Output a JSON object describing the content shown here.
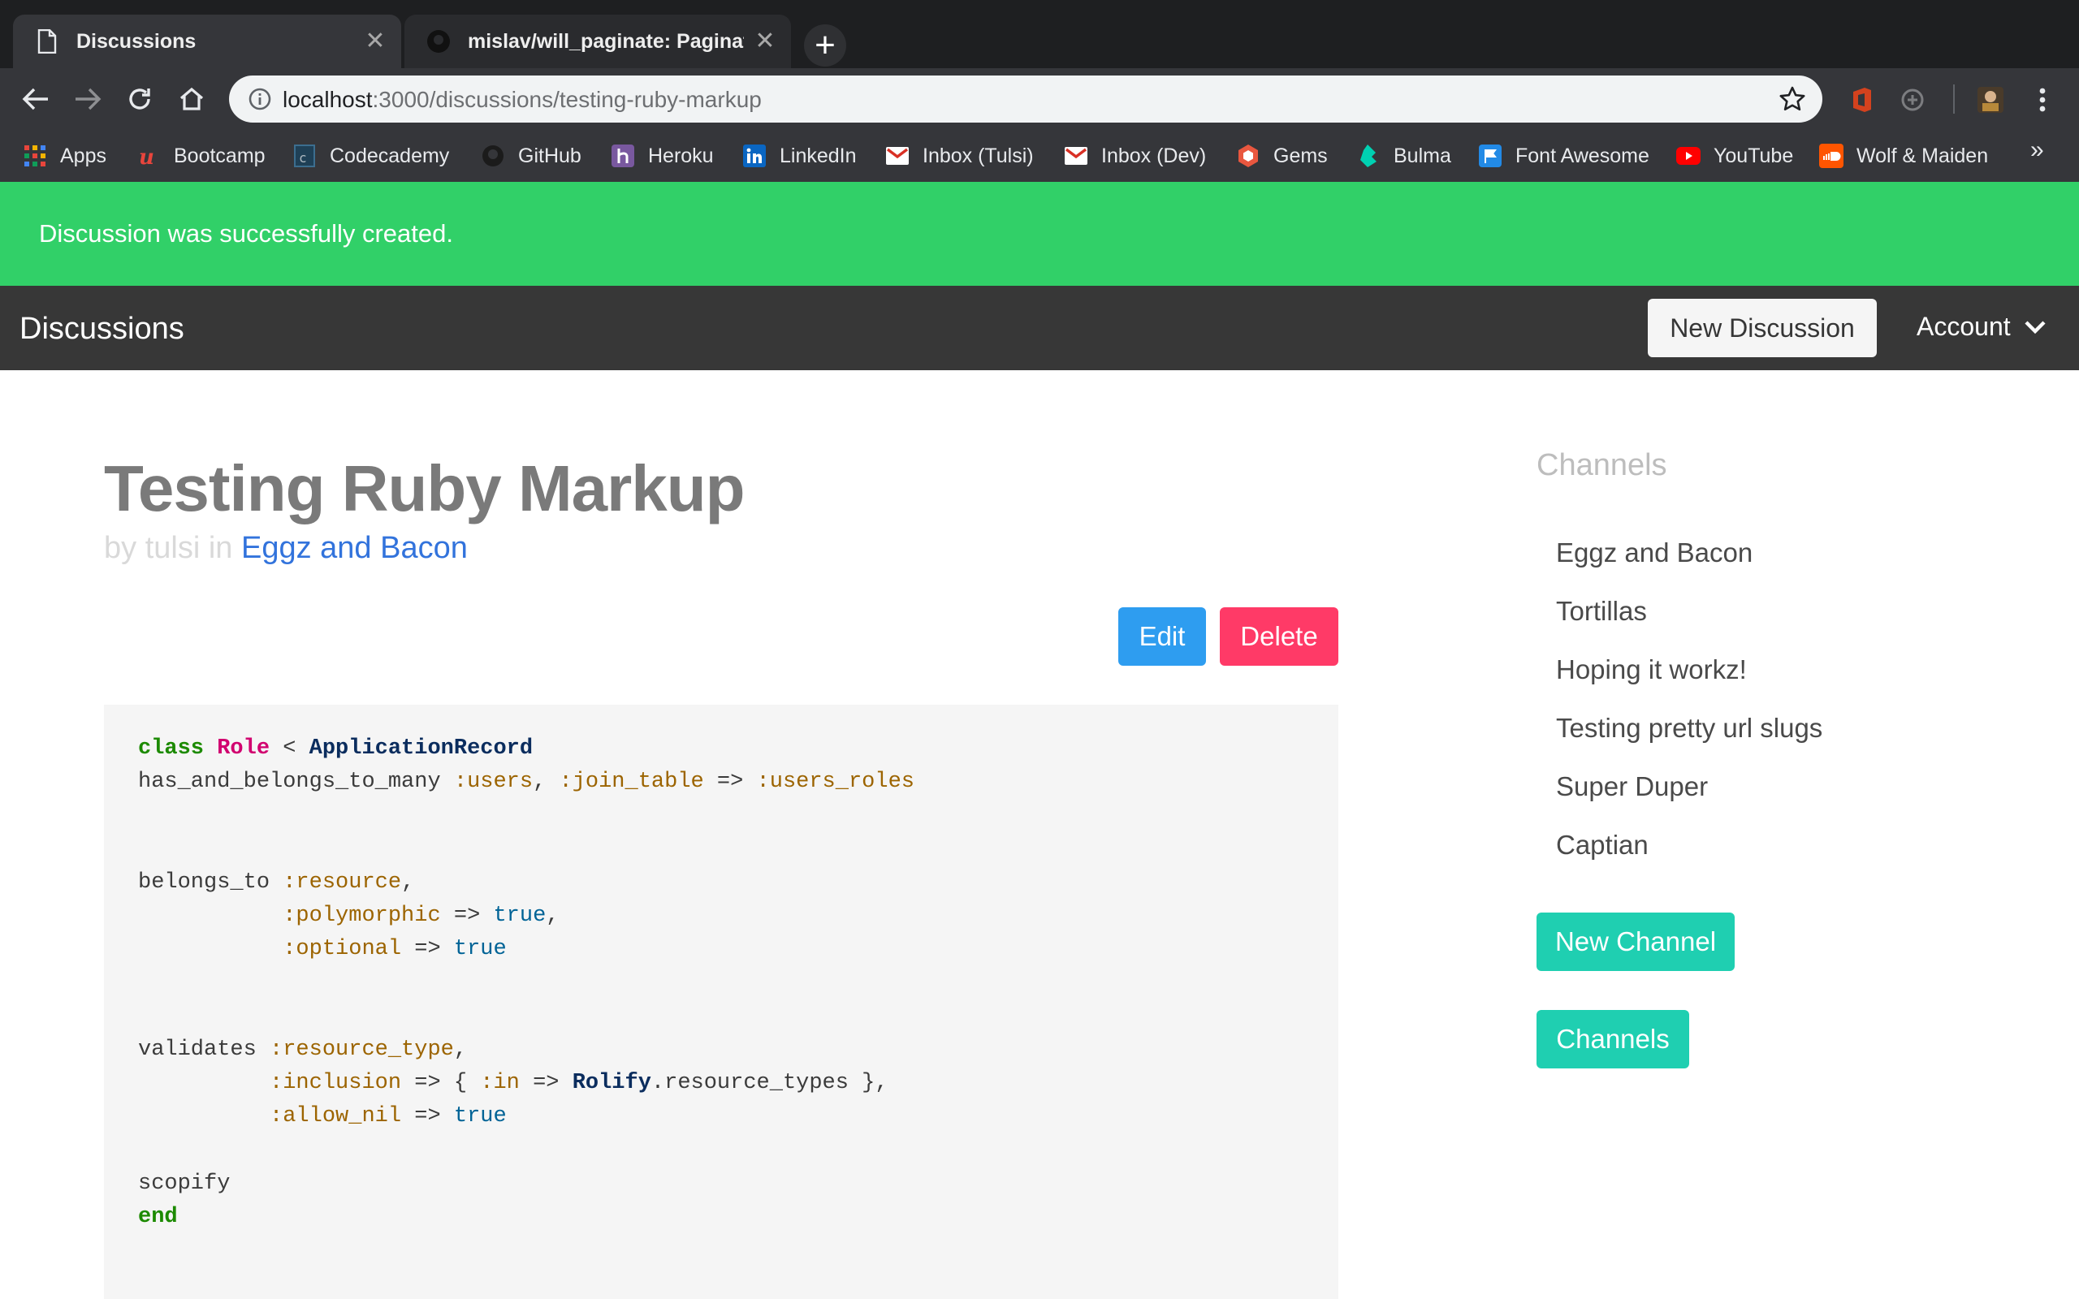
{
  "browser": {
    "tabs": [
      {
        "title": "Discussions",
        "active": true
      },
      {
        "title": "mislav/will_paginate: Pagination library for Rails",
        "active": false
      }
    ],
    "new_tab_glyph": "+",
    "close_glyph": "✕",
    "url_host": "localhost",
    "url_path": ":3000/discussions/testing-ruby-markup",
    "bookmarks": [
      {
        "label": "Apps",
        "icon": "apps-grid-icon"
      },
      {
        "label": "Bootcamp",
        "icon": "bootcamp-icon"
      },
      {
        "label": "Codecademy",
        "icon": "codecademy-icon"
      },
      {
        "label": "GitHub",
        "icon": "github-icon"
      },
      {
        "label": "Heroku",
        "icon": "heroku-icon"
      },
      {
        "label": "LinkedIn",
        "icon": "linkedin-icon"
      },
      {
        "label": "Inbox (Tulsi)",
        "icon": "gmail-icon"
      },
      {
        "label": "Inbox (Dev)",
        "icon": "gmail-icon"
      },
      {
        "label": "Gems",
        "icon": "rubygems-icon"
      },
      {
        "label": "Bulma",
        "icon": "bulma-icon"
      },
      {
        "label": "Font Awesome",
        "icon": "font-awesome-icon"
      },
      {
        "label": "YouTube",
        "icon": "youtube-icon"
      },
      {
        "label": "Wolf & Maiden",
        "icon": "soundcloud-icon"
      }
    ],
    "bookmarks_overflow": "»"
  },
  "flash": {
    "message": "Discussion was successfully created."
  },
  "navbar": {
    "brand": "Discussions",
    "new_discussion": "New Discussion",
    "account": "Account"
  },
  "discussion": {
    "title": "Testing Ruby Markup",
    "by_prefix": "by tulsi in ",
    "channel": "Eggz and Bacon",
    "edit": "Edit",
    "delete": "Delete"
  },
  "code": {
    "language": "ruby",
    "lines": [
      "class Role < ApplicationRecord",
      "has_and_belongs_to_many :users, :join_table => :users_roles",
      "",
      "",
      "belongs_to :resource,",
      "           :polymorphic => true,",
      "           :optional => true",
      "",
      "",
      "validates :resource_type,",
      "          :inclusion => { :in => Rolify.resource_types },",
      "          :allow_nil => true",
      "",
      "scopify",
      "end"
    ]
  },
  "sidebar": {
    "heading": "Channels",
    "channels": [
      "Eggz and Bacon",
      "Tortillas",
      "Hoping it workz!",
      "Testing pretty url slugs",
      "Super Duper",
      "Captian"
    ],
    "new_channel": "New Channel",
    "channels_button": "Channels"
  },
  "colors": {
    "flash_bg": "#31d068",
    "navbar_bg": "#373737",
    "primary_info": "#2e9df0",
    "danger": "#ff3a67",
    "primary": "#1fcfb1",
    "link": "#3273dc"
  }
}
